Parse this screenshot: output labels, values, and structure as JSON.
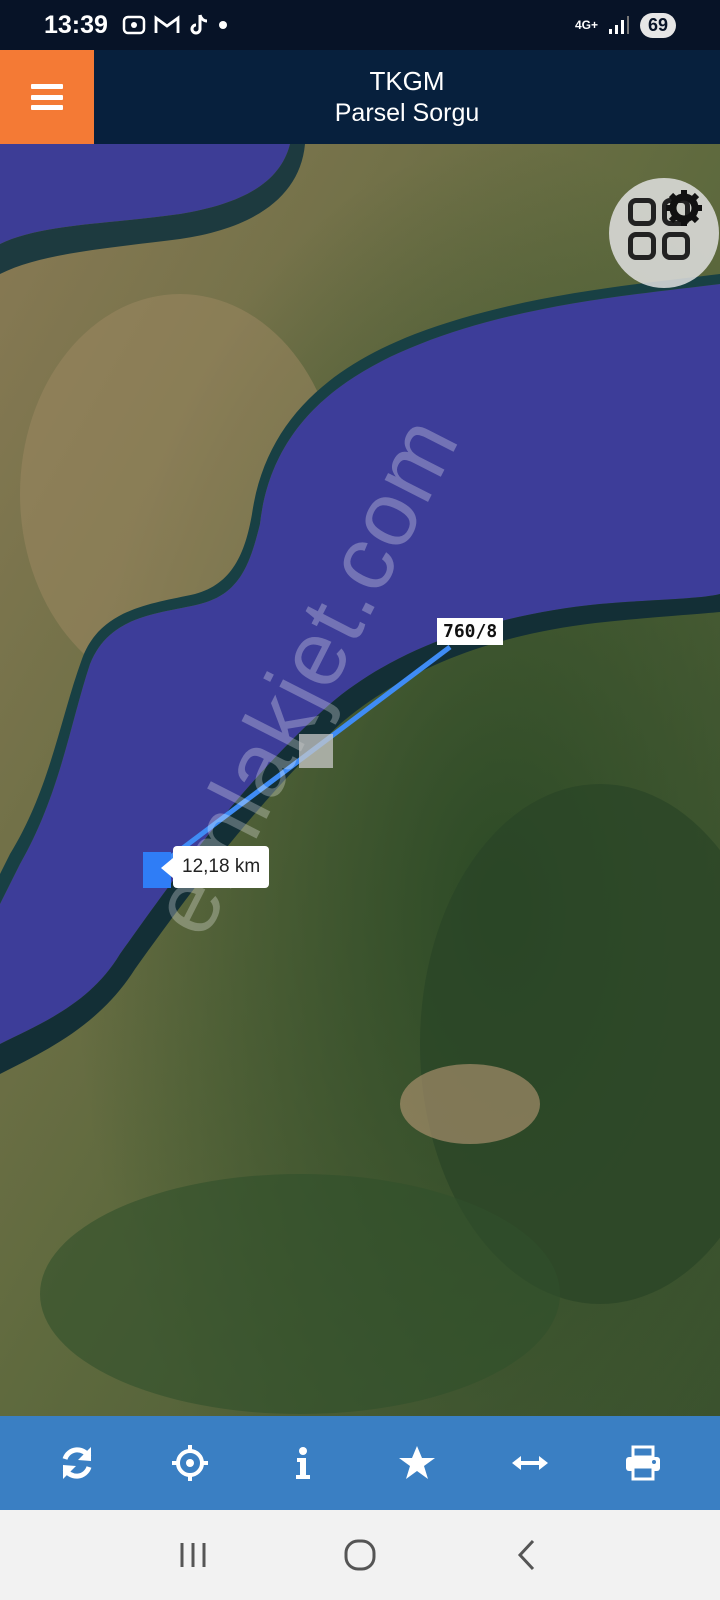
{
  "status_bar": {
    "time": "13:39",
    "icons": [
      "screenshot-icon",
      "gmail-icon",
      "tiktok-icon",
      "dot-icon"
    ],
    "network": "4G+",
    "battery": "69"
  },
  "header": {
    "title": "TKGM",
    "subtitle": "Parsel Sorgu",
    "menu_icon": "menu-icon",
    "menu_color": "#f47a35"
  },
  "map": {
    "parcel_label": "760/8",
    "distance": "12,18 km",
    "watermark": "emlakjet.com",
    "layer_icon": "gear-icon",
    "measure_color": "#2f7df6"
  },
  "toolbar": {
    "color": "#3a7fc3",
    "buttons": [
      "refresh-icon",
      "locate-icon",
      "info-icon",
      "star-icon",
      "measure-icon",
      "print-icon"
    ]
  },
  "nav_bar": {
    "buttons": [
      "recent-apps-icon",
      "home-icon",
      "back-icon"
    ]
  }
}
